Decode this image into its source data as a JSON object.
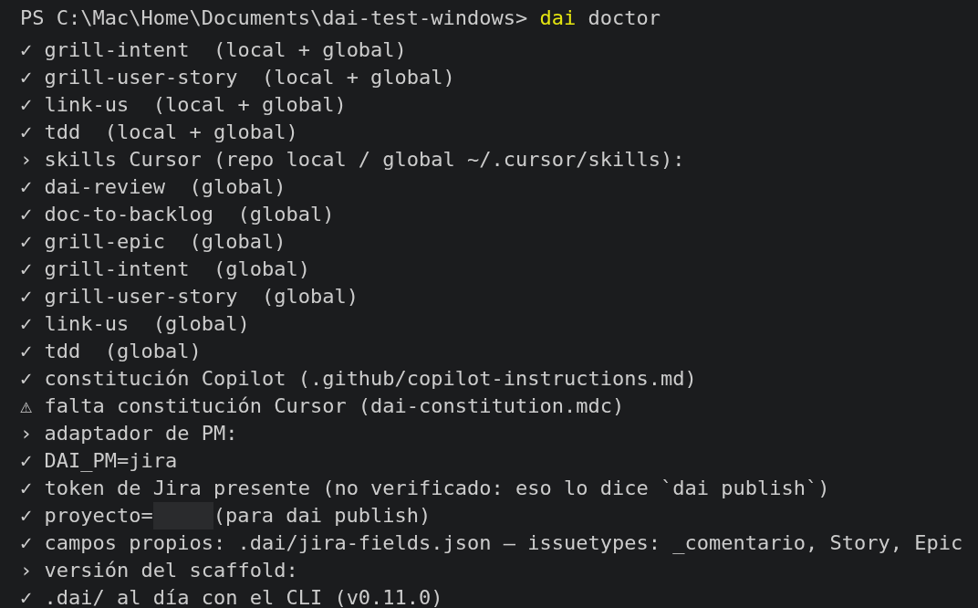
{
  "prompt": {
    "path": "PS C:\\Mac\\Home\\Documents\\dai-test-windows>",
    "command": "dai",
    "args": "doctor"
  },
  "lines": [
    {
      "mark": "✓",
      "text": "grill-intent  (local + global)"
    },
    {
      "mark": "✓",
      "text": "grill-user-story  (local + global)"
    },
    {
      "mark": "✓",
      "text": "link-us  (local + global)"
    },
    {
      "mark": "✓",
      "text": "tdd  (local + global)"
    },
    {
      "mark": "›",
      "text": "skills Cursor (repo local / global ~/.cursor/skills):"
    },
    {
      "mark": "✓",
      "text": "dai-review  (global)"
    },
    {
      "mark": "✓",
      "text": "doc-to-backlog  (global)"
    },
    {
      "mark": "✓",
      "text": "grill-epic  (global)"
    },
    {
      "mark": "✓",
      "text": "grill-intent  (global)"
    },
    {
      "mark": "✓",
      "text": "grill-user-story  (global)"
    },
    {
      "mark": "✓",
      "text": "link-us  (global)"
    },
    {
      "mark": "✓",
      "text": "tdd  (global)"
    },
    {
      "mark": "✓",
      "text": "constitución Copilot (.github/copilot-instructions.md)"
    },
    {
      "mark": "⚠",
      "text": "falta constitución Cursor (dai-constitution.mdc)"
    },
    {
      "mark": "›",
      "text": "adaptador de PM:"
    },
    {
      "mark": "✓",
      "text": "DAI_PM=jira"
    },
    {
      "mark": "✓",
      "text": "token de Jira presente (no verificado: eso lo dice `dai publish`)"
    },
    {
      "mark": "✓",
      "text": "proyecto=",
      "redacted": true,
      "after": "(para dai publish)"
    },
    {
      "mark": "✓",
      "text": "campos propios: .dai/jira-fields.json — issuetypes: _comentario, Story, Epic"
    },
    {
      "mark": "›",
      "text": "versión del scaffold:"
    },
    {
      "mark": "✓",
      "text": ".dai/ al día con el CLI (v0.11.0)"
    }
  ]
}
